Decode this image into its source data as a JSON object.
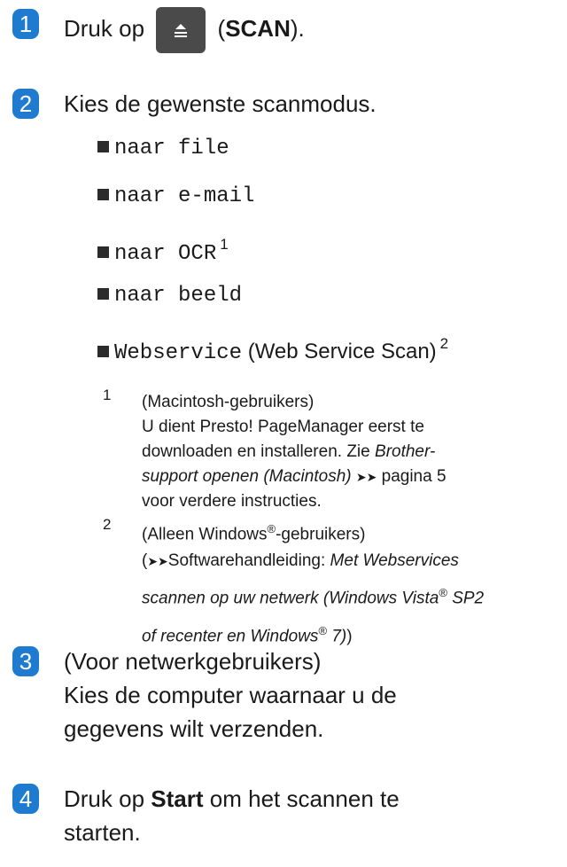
{
  "steps": [
    {
      "num": "1",
      "prefix": "Druk op",
      "paren_open": "(",
      "bold": "SCAN",
      "paren_close": ")."
    },
    {
      "num": "2",
      "text": "Kies de gewenste scanmodus."
    },
    {
      "num": "3",
      "line1": "(Voor netwerkgebruikers)",
      "line2": "Kies de computer waarnaar u de",
      "line3": "gegevens wilt verzenden."
    },
    {
      "num": "4",
      "prefix": "Druk op",
      "bold": "Start",
      "line1_rest": "om het scannen te",
      "line2": "starten."
    }
  ],
  "modes": [
    {
      "label": "naar file",
      "sup": ""
    },
    {
      "label": "naar e-mail",
      "sup": ""
    },
    {
      "label": "naar OCR",
      "sup": "1"
    },
    {
      "label": "naar beeld",
      "sup": ""
    },
    {
      "label": "Webservice",
      "suffix": "(Web Service Scan)",
      "sup": "2"
    }
  ],
  "footnotes": {
    "fn1": {
      "num": "1",
      "line1": "(Macintosh-gebruikers)",
      "line2": "U dient Presto! PageManager eerst te",
      "line3": "downloaden en installeren. Zie",
      "link_a": "Brother-",
      "link_b": "support openen (Macintosh)",
      "arrow": "➤➤",
      "page_ref": "pagina 5",
      "line5": "voor verdere instructies."
    },
    "fn2": {
      "num": "2",
      "line1a": "(Alleen Windows",
      "reg": "®",
      "line1b": "-gebruikers)",
      "line2a": "(",
      "arrow": "➤➤",
      "line2b": "Softwarehandleiding:",
      "line2c": "Met Webservices",
      "line3a": "scannen op uw netwerk (Windows Vista",
      "line3b": "SP2",
      "line4a": "of recenter en Windows",
      "line4b": "7)",
      "line4c": ")"
    }
  },
  "colors": {
    "accent": "#1e7bd0",
    "button": "#4a4a4a"
  },
  "icons": {
    "scan_button": "scan-icon",
    "step_marker": "step-number-badge"
  }
}
